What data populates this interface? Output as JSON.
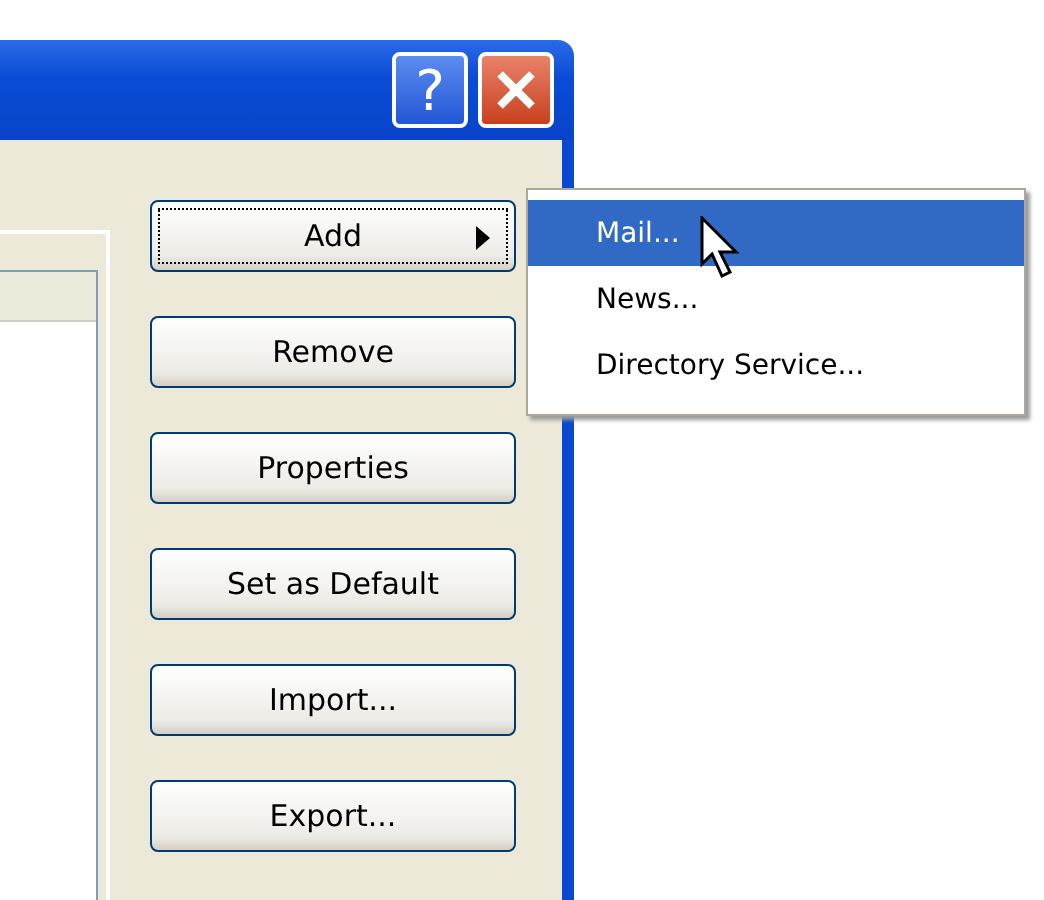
{
  "title_bar": {
    "help_button": "?"
  },
  "buttons": [
    {
      "label": "Add",
      "focused": true,
      "submenu": true
    },
    {
      "label": "Remove",
      "focused": false,
      "submenu": false
    },
    {
      "label": "Properties",
      "focused": false,
      "submenu": false
    },
    {
      "label": "Set as Default",
      "focused": false,
      "submenu": false
    },
    {
      "label": "Import...",
      "focused": false,
      "submenu": false
    },
    {
      "label": "Export...",
      "focused": false,
      "submenu": false
    }
  ],
  "add_menu": {
    "items": [
      {
        "label": "Mail...",
        "selected": true
      },
      {
        "label": "News...",
        "selected": false
      },
      {
        "label": "Directory Service...",
        "selected": false
      }
    ]
  }
}
